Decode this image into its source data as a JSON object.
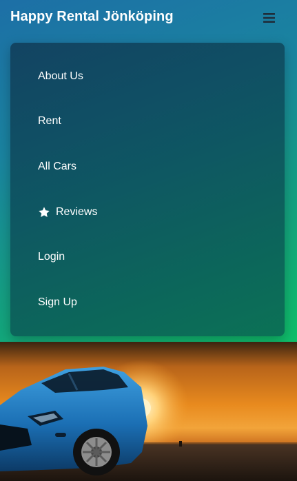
{
  "navbar": {
    "brand": "Happy Rental Jönköping",
    "toggle_icon": "hamburger-menu-icon"
  },
  "menu": {
    "items": [
      {
        "label": "About Us"
      },
      {
        "label": "Rent"
      },
      {
        "label": "All Cars"
      },
      {
        "label": "Reviews",
        "icon": "star-icon"
      },
      {
        "label": "Login"
      },
      {
        "label": "Sign Up"
      }
    ]
  },
  "hero": {
    "image": "blue-suv-at-sunset"
  },
  "colors": {
    "gradient_start": "#1d6fa6",
    "gradient_end": "#0fbf6a",
    "text": "#ffffff"
  }
}
